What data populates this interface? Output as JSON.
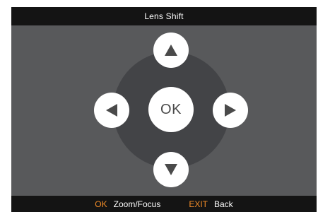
{
  "title": "Lens Shift",
  "center_button": {
    "label": "OK"
  },
  "arrows": {
    "up": "arrow-up",
    "down": "arrow-down",
    "left": "arrow-left",
    "right": "arrow-right"
  },
  "footer": {
    "ok_key": "OK",
    "ok_action": "Zoom/Focus",
    "exit_key": "EXIT",
    "exit_action": "Back"
  },
  "colors": {
    "background": "#58595b",
    "bars": "#141414",
    "pad": "#434447",
    "accent": "#f28c28",
    "button": "#ffffff",
    "glyph": "#4a4a4a"
  }
}
